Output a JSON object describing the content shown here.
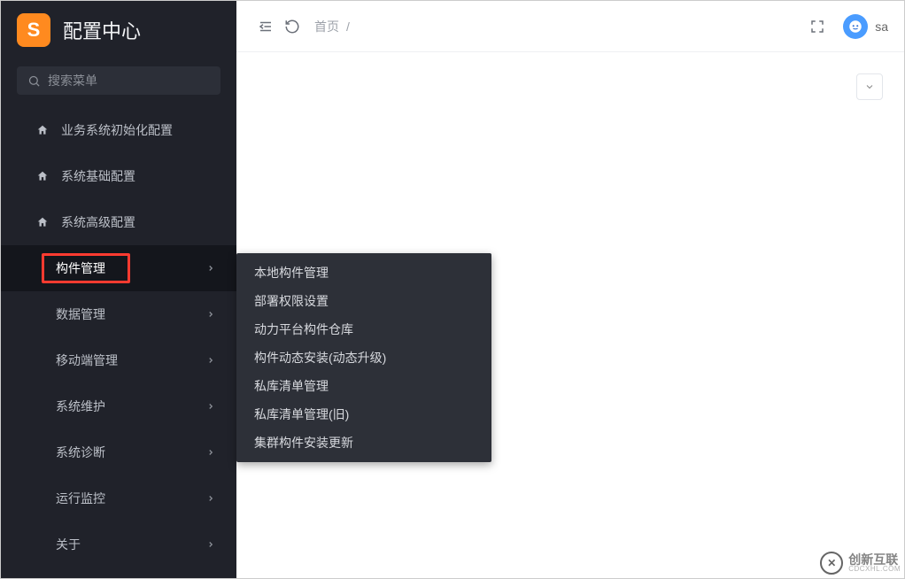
{
  "app": {
    "logo_letter": "S",
    "title": "配置中心"
  },
  "search": {
    "placeholder": "搜索菜单"
  },
  "nav": {
    "items": [
      {
        "label": "业务系统初始化配置",
        "icon": "home",
        "expandable": false
      },
      {
        "label": "系统基础配置",
        "icon": "home",
        "expandable": false
      },
      {
        "label": "系统高级配置",
        "icon": "home",
        "expandable": false
      }
    ],
    "sub_items": [
      {
        "label": "构件管理",
        "expandable": true,
        "active": true,
        "highlighted": true
      },
      {
        "label": "数据管理",
        "expandable": true
      },
      {
        "label": "移动端管理",
        "expandable": true
      },
      {
        "label": "系统维护",
        "expandable": true
      },
      {
        "label": "系统诊断",
        "expandable": true
      },
      {
        "label": "运行监控",
        "expandable": true
      },
      {
        "label": "关于",
        "expandable": true
      }
    ]
  },
  "popover": {
    "items": [
      "本地构件管理",
      "部署权限设置",
      "动力平台构件仓库",
      "构件动态安装(动态升级)",
      "私库清单管理",
      "私库清单管理(旧)",
      "集群构件安装更新"
    ]
  },
  "header": {
    "breadcrumb": "首页",
    "breadcrumb_sep": "/",
    "username": "sa"
  },
  "watermark": {
    "main": "创新互联",
    "sub": "CDCXHL.COM"
  }
}
